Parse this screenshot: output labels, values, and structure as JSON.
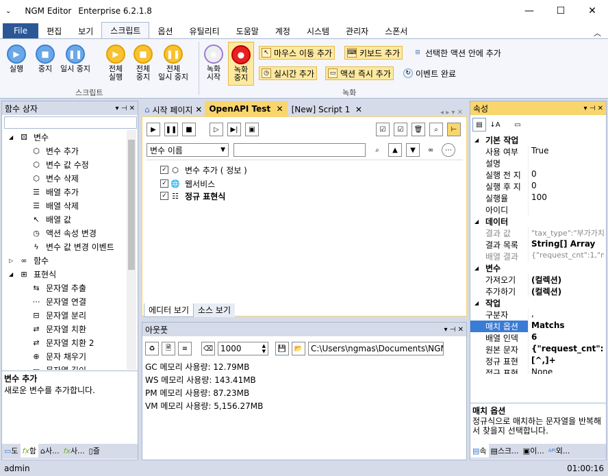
{
  "window": {
    "title": "NGM Editor",
    "edition": "Enterprise 6.2.1.8"
  },
  "menu_tabs": [
    "File",
    "편집",
    "보기",
    "스크립트",
    "옵션",
    "유틸리티",
    "도움말",
    "계정",
    "시스템",
    "관리자",
    "스폰서"
  ],
  "ribbon": {
    "script_group": {
      "label": "스크립트",
      "buttons": [
        "실행",
        "중지",
        "일시 중지"
      ]
    },
    "all_buttons": [
      [
        "전체",
        "실행"
      ],
      [
        "전체",
        "중지"
      ],
      [
        "전체",
        "일시 중지"
      ]
    ],
    "record_group": {
      "label": "녹화",
      "start": [
        "녹화",
        "시작"
      ],
      "stop": [
        "녹화",
        "중지"
      ]
    },
    "small_buttons": [
      "마우스 이동 추가",
      "키보드 추가",
      "선택한 액션 안에 추가",
      "실시간 추가",
      "액션 즉시 추가",
      "이벤트 완료"
    ]
  },
  "left_panel": {
    "title": "함수 상자",
    "tree": [
      {
        "label": "변수",
        "level": 0,
        "icon": "variable-icon"
      },
      {
        "label": "변수 추가",
        "level": 1
      },
      {
        "label": "변수 값 수정",
        "level": 1
      },
      {
        "label": "변수 삭제",
        "level": 1
      },
      {
        "label": "배열 추가",
        "level": 1
      },
      {
        "label": "배열 삭제",
        "level": 1
      },
      {
        "label": "배열 값",
        "level": 1
      },
      {
        "label": "액션 속성 변경",
        "level": 1
      },
      {
        "label": "변수 값 변경 이벤트",
        "level": 1
      },
      {
        "label": "함수",
        "level": 0
      },
      {
        "label": "표현식",
        "level": 0
      },
      {
        "label": "문자열 추출",
        "level": 1
      },
      {
        "label": "문자열 연결",
        "level": 1
      },
      {
        "label": "문자열 분리",
        "level": 1
      },
      {
        "label": "문자열 치환",
        "level": 1
      },
      {
        "label": "문자열 치환 2",
        "level": 1
      },
      {
        "label": "문자 채우기",
        "level": 1
      },
      {
        "label": "문자열 길이",
        "level": 1
      }
    ],
    "desc_title": "변수 추가",
    "desc_text": "새로운 변수를 추가합니다.",
    "bottom_tabs": [
      "도",
      "함",
      "사...",
      "사...",
      "즐"
    ]
  },
  "doc_tabs": [
    "시작 페이지",
    "OpenAPI Test",
    "[New] Script 1"
  ],
  "editor": {
    "combo_value": "변수 이름",
    "search_value": "",
    "actions": [
      "변수 추가 ( 정보 )",
      "웹서비스",
      "정규 표현식"
    ],
    "view_tabs": [
      "에디터 보기",
      "소스 보기"
    ]
  },
  "output": {
    "title": "아웃풋",
    "count": "1000",
    "path": "C:\\Users\\ngmas\\Documents\\NGM6\\",
    "lines": [
      "GC 메모리 사용량: 12.79MB",
      "WS 메모리 사용량: 143.41MB",
      "PM 메모리 사용량: 87.23MB",
      "VM 메모리 사용량: 5,156.27MB"
    ]
  },
  "properties": {
    "title": "속성",
    "rows": [
      {
        "cat": "기본 작업"
      },
      {
        "k": "사용 여부",
        "v": "True"
      },
      {
        "k": "설명",
        "v": ""
      },
      {
        "k": "실행 전 지",
        "v": "0"
      },
      {
        "k": "실행 후 지",
        "v": "0"
      },
      {
        "k": "실행율",
        "v": "100"
      },
      {
        "k": "아이디",
        "v": ""
      },
      {
        "cat": "데이터"
      },
      {
        "k": "결과 값",
        "v": "\"tax_type\":\"부가가치"
      },
      {
        "k": "결과 목록",
        "v": "String[] Array"
      },
      {
        "k": "배열 결과",
        "v": "{\"request_cnt\":1,\"ma"
      },
      {
        "cat": "변수"
      },
      {
        "k": "가져오기",
        "v": "(컬렉션)"
      },
      {
        "k": "추가하기",
        "v": "(컬렉션)"
      },
      {
        "cat": "작업"
      },
      {
        "k": "구분자",
        "v": ","
      },
      {
        "k": "매치 옵션",
        "v": "Matchs"
      },
      {
        "k": "배열 인덱",
        "v": "6"
      },
      {
        "k": "원본 문자",
        "v": "{\"request_cnt\":1,"
      },
      {
        "k": "정규 표현",
        "v": "[^,]+"
      },
      {
        "k": "정규 표현",
        "v": "None"
      }
    ],
    "desc_title": "매치 옵션",
    "desc_text": "정규식으로 매치하는 문자열을 반복해서 찾을지 선택합니다.",
    "bottom_tabs": [
      "속",
      "스크...",
      "이...",
      "외..."
    ]
  },
  "status": {
    "user": "admin",
    "time": "01:00:16"
  }
}
